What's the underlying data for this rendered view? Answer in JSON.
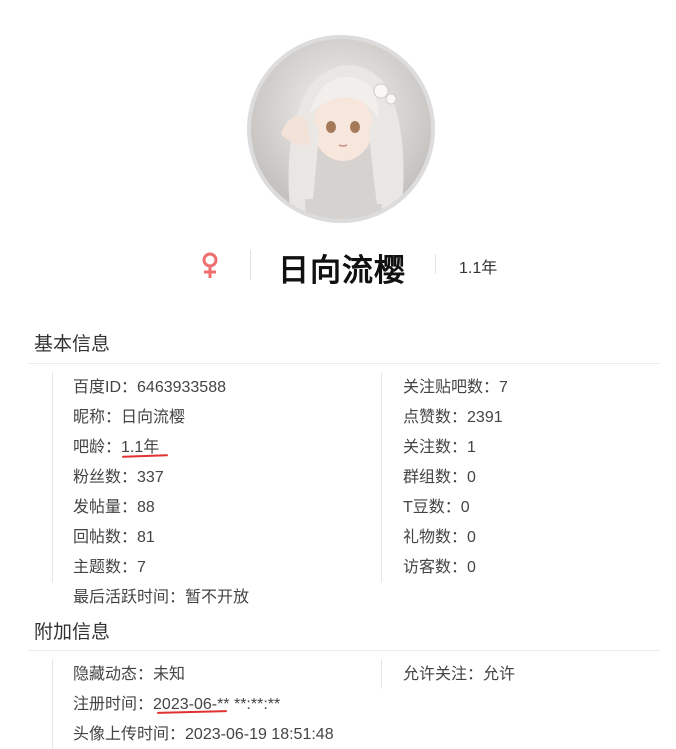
{
  "profile": {
    "username": "日向流樱",
    "gender_symbol": "♀",
    "account_age": "1.1年"
  },
  "colors": {
    "gender": "#ee6f6f",
    "annotation": "#e03232"
  },
  "basic": {
    "title": "基本信息",
    "left": [
      {
        "label": "百度ID：",
        "value": "6463933588"
      },
      {
        "label": "昵称：",
        "value": "日向流樱"
      },
      {
        "label": "吧龄：",
        "value": "1.1年"
      },
      {
        "label": "粉丝数：",
        "value": "337"
      },
      {
        "label": "发帖量：",
        "value": "88"
      },
      {
        "label": "回帖数：",
        "value": "81"
      },
      {
        "label": "主题数：",
        "value": "7"
      },
      {
        "label": "最后活跃时间：",
        "value": "暂不开放"
      }
    ],
    "right": [
      {
        "label": "关注贴吧数：",
        "value": "7"
      },
      {
        "label": "点赞数：",
        "value": "2391"
      },
      {
        "label": "关注数：",
        "value": "1"
      },
      {
        "label": "群组数：",
        "value": "0"
      },
      {
        "label": "T豆数：",
        "value": "0"
      },
      {
        "label": "礼物数：",
        "value": "0"
      },
      {
        "label": "访客数：",
        "value": "0"
      }
    ]
  },
  "extra": {
    "title": "附加信息",
    "left": [
      {
        "label": "隐藏动态：",
        "value": "未知"
      },
      {
        "label": "注册时间：",
        "value": "2023-06-** **:**:**"
      },
      {
        "label": "头像上传时间：",
        "value": "2023-06-19 18:51:48"
      }
    ],
    "right": [
      {
        "label": "允许关注：",
        "value": "允许"
      }
    ]
  }
}
